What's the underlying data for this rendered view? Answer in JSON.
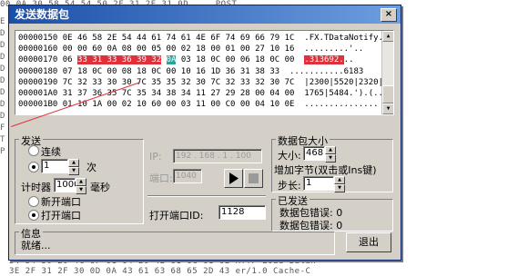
{
  "background": {
    "top_line": "00 0A 30 58 54 54 50 2F 31 2E 31 0D ...  POST",
    "left_letters": [
      "E",
      "D",
      "D",
      "D",
      "D",
      "D",
      "D",
      "D",
      "D",
      "F",
      "T",
      "P"
    ],
    "bottom_lines": [
      "54 54 50 20 4C 6F 61 64 20 42 61 6C 61 6E   HTTP Load Balan",
      "3E 2F 31 2F 30 0D 0A 43 61 63 68 65 2D 43   er/1.0  Cache-C"
    ]
  },
  "dialog": {
    "title": "发送数据包",
    "close_label": "×"
  },
  "hex_view": {
    "lines": [
      {
        "pre": "00000150 0E 46 58 2E 54 44 61 74 61 4E 6F 74 69 66 79 1C  .FX.TDataNotify."
      },
      {
        "pre": "00000160 00 00 60 0A 08 00 05 00 02 18 00 01 00 27 10 16  .........'.."
      },
      {
        "pre": "00000170 06 ",
        "red": "33 31 33 36 39 32",
        "mid": " ",
        "teal": "0A",
        "post": " 03 18 0C 00 06 18 0C 00  ",
        "red2": ".313692.",
        "end": ".."
      },
      {
        "pre": "00000180 07 18 0C 00 08 18 0C 00 10 16 1D 36 31 38 33  ...........6183"
      },
      {
        "pre": "00000190 7C 32 33 30 30 7C 35 35 32 30 7C 32 33 32 30 7C  |2300|5520|2320|"
      },
      {
        "pre": "000001A0 31 37 36 35 7C 35 34 38 34 11 27 29 28 00 04 00  1765|5484.').(.."
      },
      {
        "pre": "000001B0 01 10 1A 00 02 10 60 00 03 11 00 C0 00 04 10 0E  ..............."
      }
    ]
  },
  "send_group": {
    "title": "发送",
    "continuous_label": "连续",
    "count_value": "1",
    "count_unit": "次",
    "timer_label": "计时器",
    "timer_value": "1000",
    "timer_unit": "毫秒",
    "new_port_label": "新开端口",
    "open_port_label": "打开端口"
  },
  "target": {
    "ip_label": "IP:",
    "ip_value": "192 . 168 . 1 . 100",
    "port_label": "端口:",
    "port_value": "1040",
    "open_port_id_label": "打开端口ID:",
    "open_port_id_value": "1128"
  },
  "size_group": {
    "title": "数据包大小",
    "size_label": "大小:",
    "size_value": "468",
    "increase_title": "增加字节(双击或Ins键)",
    "step_label": "步长:",
    "step_value": "1"
  },
  "sent_group": {
    "title": "已发送",
    "sent_errors": "数据包错误: 0",
    "packet_errors": "数据包错误: 0"
  },
  "info_group": {
    "title": "信息",
    "status": "就绪..."
  },
  "exit_label": "退出",
  "colors": {
    "highlight_red": "#e0303a",
    "highlight_teal": "#2aa19a",
    "title_blue": "#1b4fa8"
  }
}
